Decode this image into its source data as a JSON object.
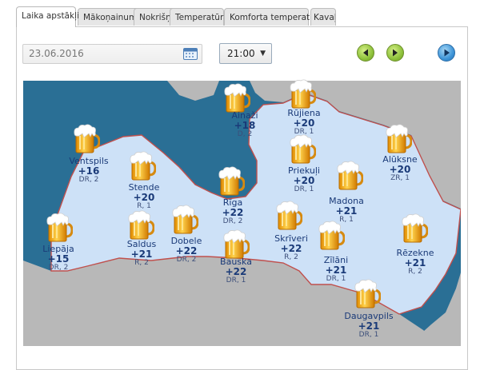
{
  "tabs": [
    {
      "label": "Laika apstākļi",
      "active": true
    },
    {
      "label": "Mākoņainums",
      "active": false
    },
    {
      "label": "Nokrišņi",
      "active": false
    },
    {
      "label": "Temperatūra",
      "active": false
    },
    {
      "label": "Komforta temperatūra",
      "active": false
    },
    {
      "label": "Kavaļ",
      "active": false
    }
  ],
  "controls": {
    "date_value": "23.06.2016",
    "time_value": "21:00",
    "calendar_icon": "calendar-icon",
    "prev_icon": "arrow-left-icon",
    "next_icon": "arrow-right-icon",
    "play_icon": "play-icon"
  },
  "colors": {
    "sea": "#2a6f95",
    "land_latvia": "#cde1f7",
    "land_neighbors": "#b8b8b8",
    "border": "#c0504d",
    "text": "#1a3a78",
    "green_button": "#8fc23c",
    "blue_button": "#3e95d8"
  },
  "map": {
    "weather_icon": "beer-mug-icon",
    "cities": [
      {
        "name": "Ainaži",
        "temp": "+18",
        "wind": "D, 2"
      },
      {
        "name": "Rūjiena",
        "temp": "+20",
        "wind": "DR, 1"
      },
      {
        "name": "Ventspils",
        "temp": "+16",
        "wind": "DR, 2"
      },
      {
        "name": "Stende",
        "temp": "+20",
        "wind": "R, 1"
      },
      {
        "name": "Rīga",
        "temp": "+22",
        "wind": "DR, 2"
      },
      {
        "name": "Priekuļi",
        "temp": "+20",
        "wind": "DR, 1"
      },
      {
        "name": "Alūksne",
        "temp": "+20",
        "wind": "ZR, 1"
      },
      {
        "name": "Madona",
        "temp": "+21",
        "wind": "R, 1"
      },
      {
        "name": "Liepāja",
        "temp": "+15",
        "wind": "DR, 2"
      },
      {
        "name": "Saldus",
        "temp": "+21",
        "wind": "R, 2"
      },
      {
        "name": "Dobele",
        "temp": "+22",
        "wind": "DR, 2"
      },
      {
        "name": "Bauska",
        "temp": "+22",
        "wind": "DR, 1"
      },
      {
        "name": "Skrīveri",
        "temp": "+22",
        "wind": "R, 2"
      },
      {
        "name": "Zīlāni",
        "temp": "+21",
        "wind": "DR, 1"
      },
      {
        "name": "Rēzekne",
        "temp": "+21",
        "wind": "R, 2"
      },
      {
        "name": "Daugavpils",
        "temp": "+21",
        "wind": "DR, 1"
      }
    ]
  }
}
